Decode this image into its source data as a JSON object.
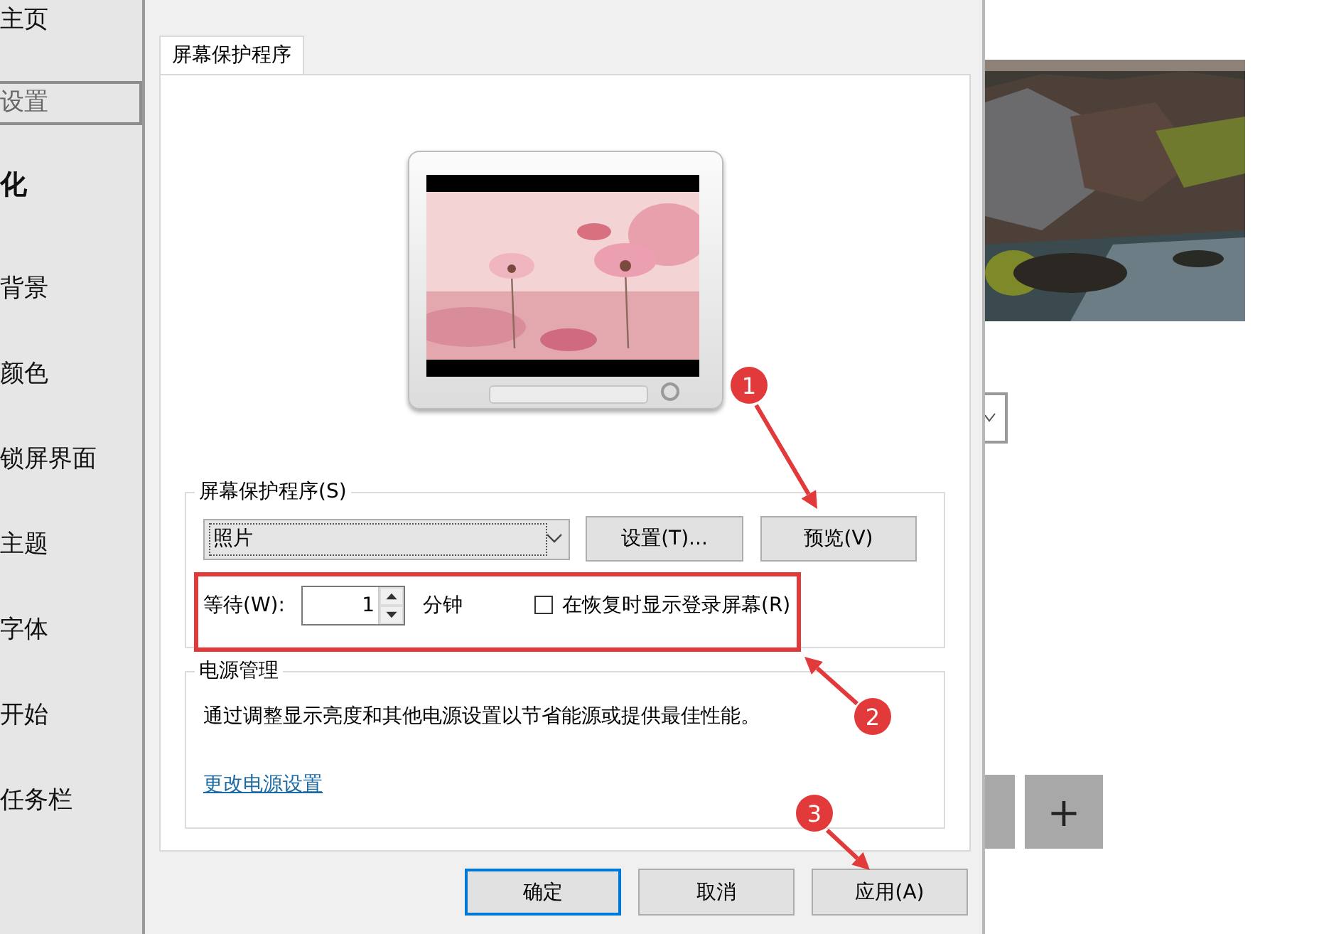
{
  "sidebar": {
    "home": "主页",
    "search": {
      "placeholder": "设置"
    },
    "heading": "化",
    "items": [
      {
        "label": "背景"
      },
      {
        "label": "颜色"
      },
      {
        "label": "锁屏界面"
      },
      {
        "label": "主题"
      },
      {
        "label": "字体"
      },
      {
        "label": "开始"
      },
      {
        "label": "任务栏"
      }
    ]
  },
  "dialog": {
    "tabs": [
      {
        "label": "屏幕保护程序",
        "selected": true
      }
    ],
    "screensaver": {
      "title": "屏幕保护程序(S)",
      "selection": "照片",
      "buttons": [
        "设置(T)...",
        "预览(V)"
      ],
      "wait_label": "等待(W):",
      "wait_value": "1",
      "wait_unit": "分钟",
      "show_logon": {
        "label": "在恢复时显示登录屏幕(R)",
        "checked": false
      }
    },
    "power": {
      "title": "电源管理",
      "description": "通过调整显示亮度和其他电源设置以节省能源或提供最佳性能。",
      "link": "更改电源设置"
    },
    "buttons": [
      {
        "label": "确定",
        "default": true
      },
      {
        "label": "取消",
        "default": false
      },
      {
        "label": "应用(A)",
        "default": false
      }
    ]
  },
  "background_panel": {
    "picture": {
      "kind": "picture"
    },
    "zoom_buttons": [
      "+"
    ]
  },
  "annotations": [
    {
      "number": "1"
    },
    {
      "number": "2"
    },
    {
      "number": "3"
    }
  ]
}
